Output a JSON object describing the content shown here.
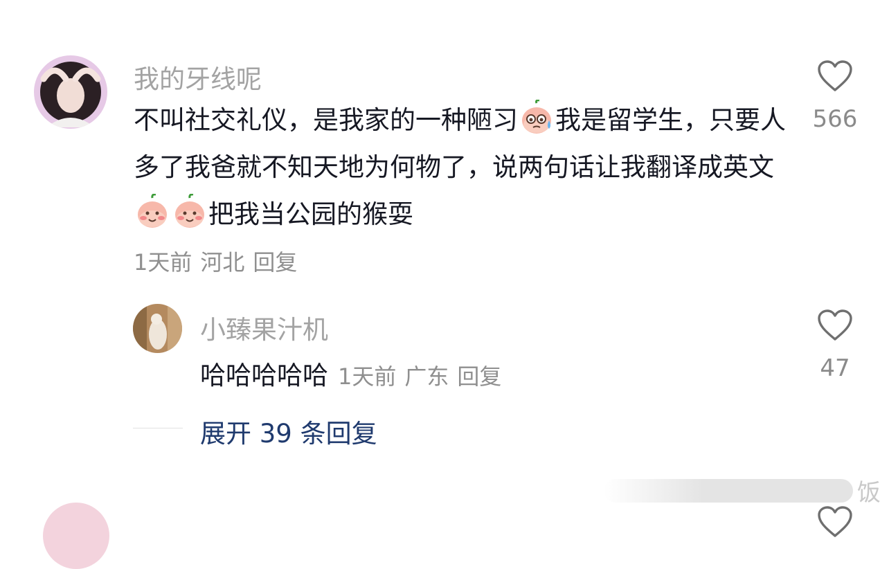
{
  "comment": {
    "username": "我的牙线呢",
    "text_part1": "不叫社交礼仪，是我家的一种陋习",
    "emoji1": "sweat-emoji",
    "text_part2": "我是留学生，只要人多了我爸就不知天地为何物了，说两句话让我翻译成英文",
    "emoji2": "blush-emoji",
    "emoji3": "blush-emoji",
    "text_part3": "把我当公园的猴耍",
    "time": "1天前",
    "location": "河北",
    "reply_label": "回复",
    "like_count": "566",
    "like_icon": "heart-outline-icon"
  },
  "reply": {
    "username": "小臻果汁机",
    "text": "哈哈哈哈哈",
    "time": "1天前",
    "location": "广东",
    "reply_label": "回复",
    "like_count": "47",
    "like_icon": "heart-outline-icon"
  },
  "expand_label": "展开 39 条回复",
  "watermark": "饭",
  "colors": {
    "text": "#161823",
    "muted": "#a3a3a3",
    "link": "#1f3a6e"
  }
}
